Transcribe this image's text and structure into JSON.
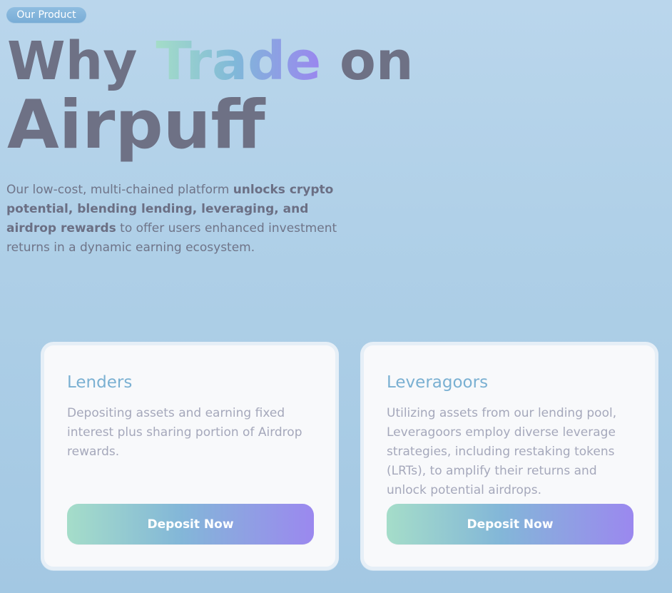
{
  "hero": {
    "badge": "Our Product",
    "headline_prefix": "Why",
    "headline_highlight": "Trade",
    "headline_suffix": "on",
    "headline_line2": "Airpuff",
    "intro": {
      "part1": "Our low-cost, multi-chained platform ",
      "bold": "unlocks crypto potential, blending lending, leveraging, and airdrop rewards",
      "part2": " to offer users enhanced investment returns in a dynamic earning ecosystem."
    }
  },
  "cards": [
    {
      "title": "Lenders",
      "description": "Depositing assets and earning fixed interest plus sharing portion of Airdrop rewards.",
      "button_label": "Deposit Now"
    },
    {
      "title": "Leveragoors",
      "description": "Utilizing assets from our lending pool, Leveragoors employ diverse leverage strategies, including restaking tokens (LRTs), to amplify their returns and unlock potential airdrops.",
      "button_label": "Deposit Now"
    }
  ],
  "colors": {
    "background_top": "#bad6ec",
    "background_bottom": "#a3c8e3",
    "headline": "#6e7185",
    "gradient_start": "#a4ddc8",
    "gradient_mid": "#80b8d9",
    "gradient_end": "#9a86ef",
    "card_background": "#f8f9fb",
    "card_title": "#7ab0d2",
    "card_text": "#a5a8bb"
  }
}
